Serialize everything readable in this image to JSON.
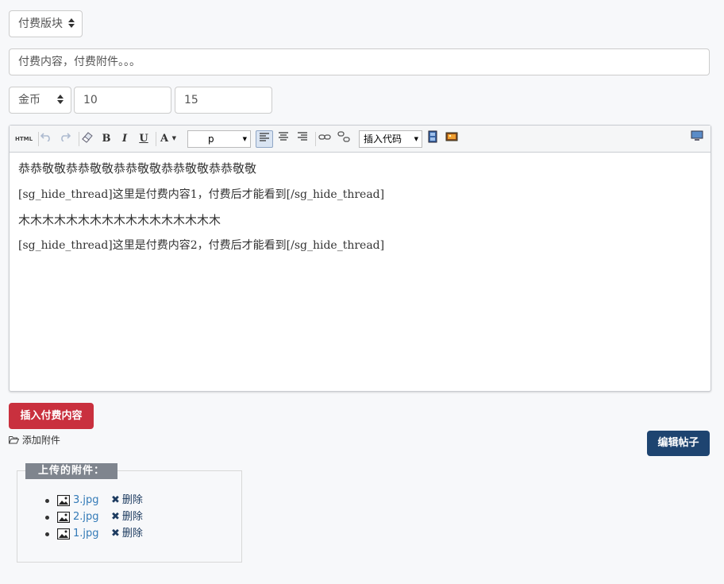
{
  "block_select": {
    "value": "付费版块"
  },
  "title_input": {
    "value": "付费内容，付费附件。。。"
  },
  "currency": {
    "value": "金币",
    "amount": "10",
    "amount2": "15"
  },
  "toolbar": {
    "html_label": "HTML",
    "format_select": "p",
    "insert_code_select": "插入代码"
  },
  "content": {
    "lines": [
      "恭恭敬敬恭恭敬敬恭恭敬敬恭恭敬敬恭恭敬敬",
      "[sg_hide_thread]这里是付费内容1，付费后才能看到[/sg_hide_thread]",
      "木木木木木木木木木木木木木木木木木",
      "[sg_hide_thread]这里是付费内容2，付费后才能看到[/sg_hide_thread]"
    ]
  },
  "buttons": {
    "insert_paid": "插入付费内容",
    "edit_post": "编辑帖子",
    "add_attachment": "添加附件"
  },
  "attachments": {
    "legend": "上传的附件：",
    "delete_label": "删除",
    "files": [
      "3.jpg",
      "2.jpg",
      "1.jpg"
    ]
  },
  "colors": {
    "danger": "#c9303e",
    "primary": "#1e4470",
    "link": "#337ab7"
  }
}
